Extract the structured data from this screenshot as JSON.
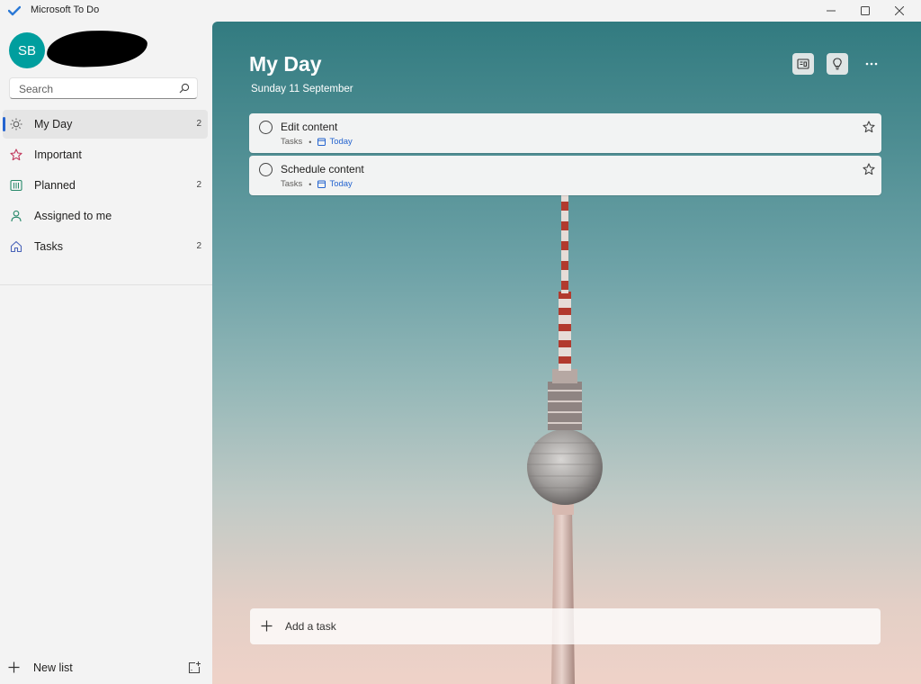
{
  "window": {
    "title": "Microsoft To Do",
    "logo_icon": "todo-checkmark-icon",
    "controls": [
      "minimize-icon",
      "maximize-icon",
      "close-icon"
    ]
  },
  "account": {
    "initials": "SB",
    "avatar_color": "#009e9e"
  },
  "search": {
    "placeholder": "Search",
    "value": ""
  },
  "sidebar": {
    "items": [
      {
        "label": "My Day",
        "icon": "sun-icon",
        "count": "2",
        "active": true
      },
      {
        "label": "Important",
        "icon": "star-icon",
        "count": ""
      },
      {
        "label": "Planned",
        "icon": "calendar-grid-icon",
        "count": "2"
      },
      {
        "label": "Assigned to me",
        "icon": "person-icon",
        "count": ""
      },
      {
        "label": "Tasks",
        "icon": "home-icon",
        "count": "2"
      }
    ],
    "new_list_label": "New list",
    "new_group_icon": "new-group-icon"
  },
  "main": {
    "title": "My Day",
    "date": "Sunday 11 September",
    "header_icons": [
      "suggestions-icon",
      "lightbulb-icon",
      "more-icon"
    ],
    "tasks": [
      {
        "title": "Edit content",
        "list": "Tasks",
        "due": "Today"
      },
      {
        "title": "Schedule content",
        "list": "Tasks",
        "due": "Today"
      }
    ],
    "add_task_label": "Add a task"
  },
  "colors": {
    "accent": "#2564cf",
    "sidebar_bg": "#f3f3f3",
    "task_bg": "#f2f3f3"
  }
}
